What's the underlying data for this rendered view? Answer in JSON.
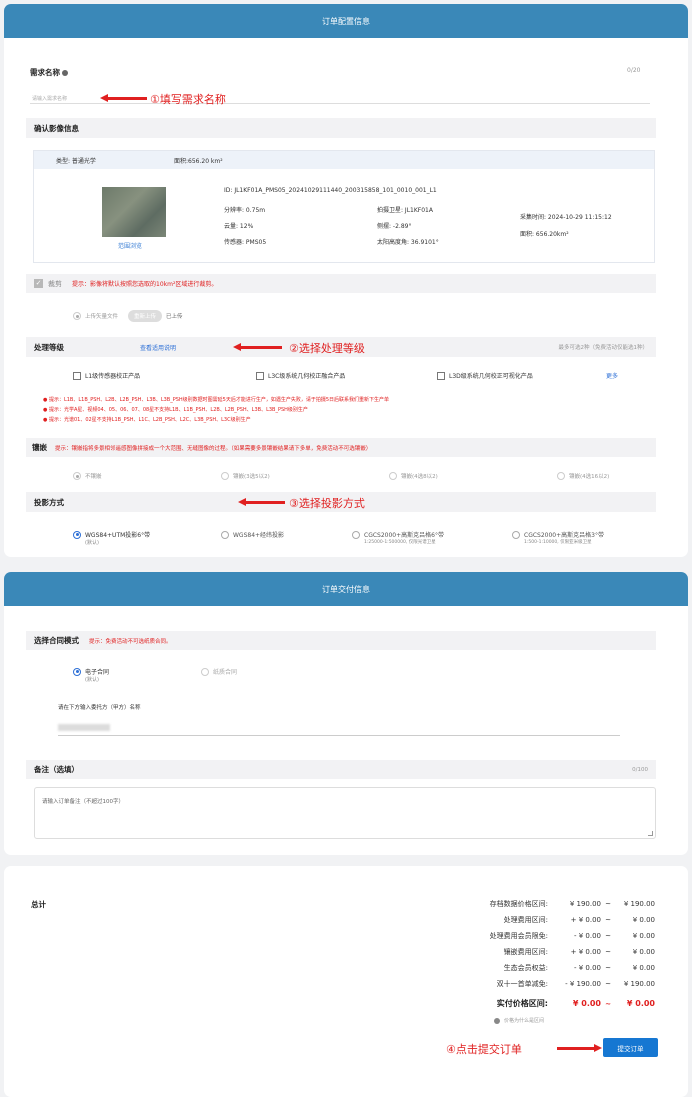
{
  "config": {
    "header": "订单配置信息",
    "req_name": {
      "label": "需求名称",
      "counter": "0/20",
      "placeholder": "请输入需求名称",
      "annot": "①填写需求名称"
    },
    "confirm": {
      "label": "确认影像信息"
    },
    "image_info": {
      "type": "类型: 普通光学",
      "area_hd": "面积:656.20 km²",
      "id": "ID: JL1KF01A_PMS05_20241029111440_200315858_101_0010_001_L1",
      "resolution": "分辨率: 0.75m",
      "satellite": "拍摄卫星: JL1KF01A",
      "cloud": "云量: 12%",
      "tilt": "侧摆: -2.89°",
      "sensor": "传感器: PMS05",
      "sun": "太阳高度角: 36.9101°",
      "time": "采集时间: 2024-10-29 11:15:12",
      "area": "面积: 656.20km²",
      "preview": "范围浏览"
    },
    "crop": {
      "label": "裁剪",
      "tip": "提示：影像将默认按照您选取的10km²区域进行裁剪。",
      "upload": "上传矢量文件",
      "reupload": "重新上传",
      "uploaded": "已上传"
    },
    "level": {
      "label": "处理等级",
      "link": "查看适用说明",
      "right": "最多可选2种（免费活动仅能选1种）",
      "annot": "②选择处理等级",
      "options": [
        "L1级传感器校正产品",
        "L3C级系统几何校正融合产品",
        "L3D级系统几何校正可视化产品"
      ],
      "more": "更多",
      "tips": [
        "提示：L1B、L1B_PSH、L2B、L2B_PSH、L3B、L3B_PSH级别数据时图需延5天后才能进行生产，如遇生产失败，请于拍摄5日后联系我们重新下生产单",
        "提示：光学A星、视频04、05、06、07、08星不支持L1B、L1B_PSH、L2B、L2B_PSH、L3B、L3B_PSH级别生产",
        "提示：光谱01、02星不支持L1B_PSH、L1C、L2B_PSH、L2C、L3B_PSH、L3C级别生产"
      ]
    },
    "mosaic": {
      "label": "镶嵌",
      "tip": "提示：镶嵌指将多景相邻遥感图像拼接成一个大范围、无缝图像的过程。（如果需要多景镶嵌结果请下多单，免费活动不可选镶嵌）",
      "options": [
        "不镶嵌",
        "镶嵌(3选5以2)",
        "镶嵌(4选8以2)",
        "镶嵌(4选16以2)"
      ]
    },
    "projection": {
      "label": "投影方式",
      "annot": "③选择投影方式",
      "options": [
        {
          "name": "WGS84+UTM投影6°带",
          "sub": "(默认)"
        },
        {
          "name": "WGS84+经纬投影",
          "sub": ""
        },
        {
          "name": "CGCS2000+高斯克吕格6°带",
          "sub": "1:25000-1:500000, 仅限光谱卫星"
        },
        {
          "name": "CGCS2000+高斯克吕格3°带",
          "sub": "1:500-1:10000, 仅限亚米级卫星"
        }
      ]
    }
  },
  "delivery": {
    "header": "订单交付信息",
    "contract": {
      "label": "选择合同模式",
      "tip": "提示：免费活动不可选纸质合同。",
      "electronic": "电子合同",
      "default": "(默认)",
      "paper": "纸质合同",
      "entrust": "请在下方输入委托方（甲方）名称"
    },
    "remark": {
      "label": "备注（选填）",
      "counter": "0/100",
      "placeholder": "请输入订单备注（不超过100字）"
    }
  },
  "total": {
    "label": "总计",
    "rows": [
      {
        "label": "存档数据价格区间:",
        "v1": "¥ 190.00",
        "til": "~",
        "v2": "¥ 190.00"
      },
      {
        "label": "处理费用区间:",
        "v1": "+ ¥ 0.00",
        "til": "~",
        "v2": "¥ 0.00"
      },
      {
        "label": "处理费用会员限免:",
        "v1": "- ¥ 0.00",
        "til": "~",
        "v2": "¥ 0.00"
      },
      {
        "label": "镶嵌费用区间:",
        "v1": "+ ¥ 0.00",
        "til": "~",
        "v2": "¥ 0.00"
      },
      {
        "label": "生态会员权益:",
        "v1": "- ¥ 0.00",
        "til": "~",
        "v2": "¥ 0.00"
      },
      {
        "label": "双十一首单减免:",
        "v1": "- ¥ 190.00",
        "til": "~",
        "v2": "¥ 190.00"
      }
    ],
    "actual": {
      "label": "实付价格区间:",
      "v1": "¥ 0.00",
      "til": "~",
      "v2": "¥ 0.00"
    },
    "why": "价格为什么是区间",
    "submit": "提交订单",
    "annot": "④点击提交订单"
  }
}
